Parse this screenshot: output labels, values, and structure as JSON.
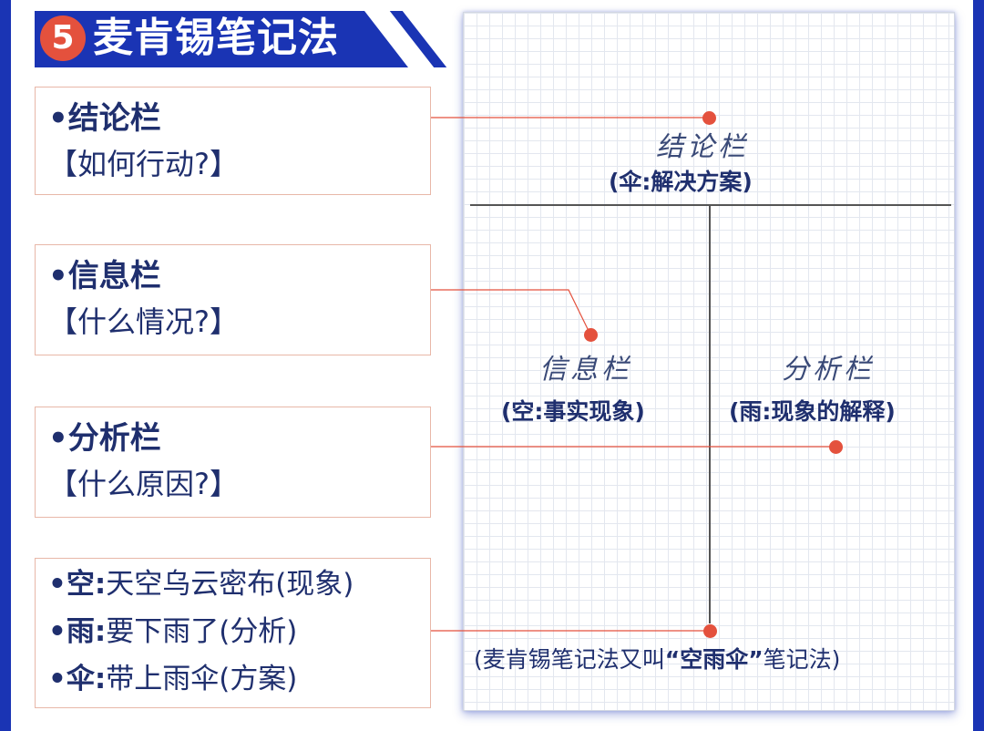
{
  "header": {
    "number": "5",
    "title": "麦肯锡笔记法"
  },
  "boxes": [
    {
      "name": "•结论栏",
      "question": "【如何行动?】"
    },
    {
      "name": "•信息栏",
      "question": "【什么情况?】"
    },
    {
      "name": "•分析栏",
      "question": "【什么原因?】"
    }
  ],
  "example": {
    "rows": [
      {
        "key": "•空:",
        "text": "天空乌云密布(现象)"
      },
      {
        "key": "•雨:",
        "text": "要下雨了(分析)"
      },
      {
        "key": "•伞:",
        "text": "带上雨伞(方案)"
      }
    ]
  },
  "paper": {
    "conclusion": {
      "title": "结论栏",
      "desc": "(伞:解决方案)"
    },
    "info": {
      "title": "信息栏",
      "desc": "(空:事实现象)"
    },
    "analysis": {
      "title": "分析栏",
      "desc": "(雨:现象的解释)"
    },
    "note": {
      "prefix": "(麦肯锡笔记法又叫",
      "highlight": "“空雨伞”",
      "suffix": "笔记法)"
    }
  },
  "colors": {
    "primary": "#1a34b4",
    "accent": "#e4513d",
    "text": "#1f2f6e",
    "box_border": "#e8b7a8"
  }
}
